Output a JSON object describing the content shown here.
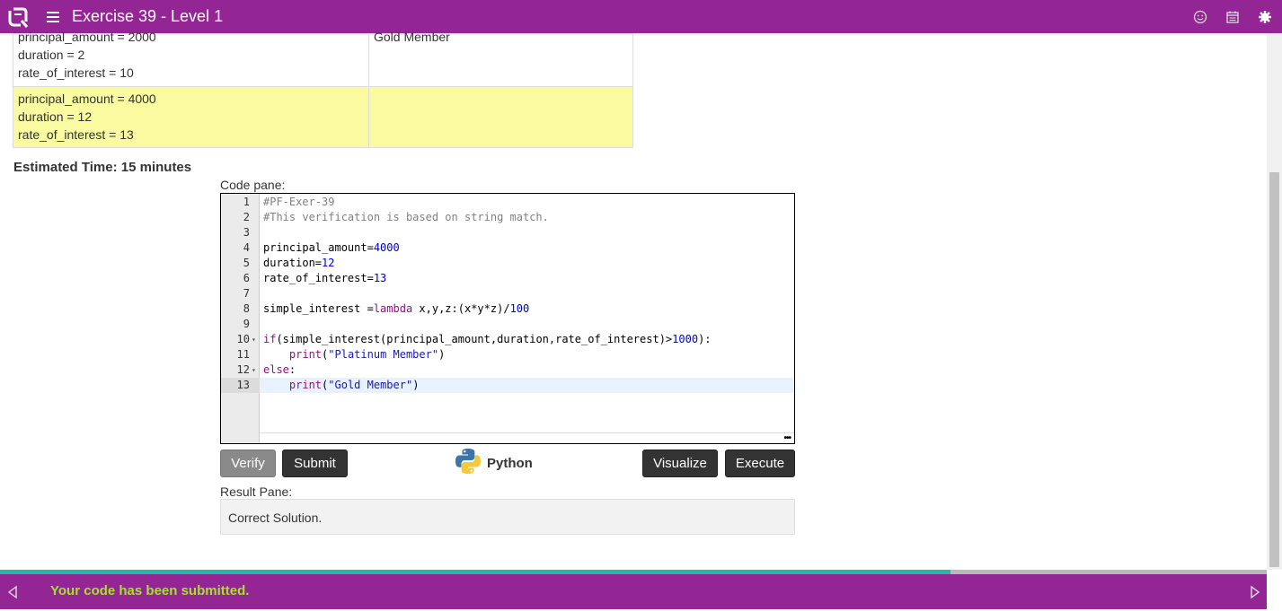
{
  "header": {
    "title": "Exercise 39 - Level 1",
    "icons": [
      "logo-icon",
      "menu-icon",
      "smiley-icon",
      "calendar-icon",
      "settings-icon"
    ]
  },
  "table": {
    "rows": [
      {
        "input": [
          "principal_amount = 2000",
          "duration = 2",
          "rate_of_interest = 10"
        ],
        "output": "Gold Member",
        "highlighted": false
      },
      {
        "input": [
          "principal_amount = 4000",
          "duration = 12",
          "rate_of_interest = 13"
        ],
        "output": "",
        "highlighted": true
      }
    ]
  },
  "estimated_time": "Estimated Time: 15 minutes",
  "code_pane": {
    "label": "Code pane:",
    "line_numbers": [
      "1",
      "2",
      "3",
      "4",
      "5",
      "6",
      "7",
      "8",
      "9",
      "10",
      "11",
      "12",
      "13"
    ],
    "lines": [
      "#PF-Exer-39",
      "#This verification is based on string match.",
      "",
      "principal_amount=4000",
      "duration=12",
      "rate_of_interest=13",
      "",
      "simple_interest =lambda x,y,z:(x*y*z)/100",
      "",
      "if(simple_interest(principal_amount,duration,rate_of_interest)>1000):",
      "    print(\"Platinum Member\")",
      "else:",
      "    print(\"Gold Member\")"
    ],
    "active_line": 13,
    "more_indicator": "•••"
  },
  "buttons": {
    "verify": "Verify",
    "submit": "Submit",
    "visualize": "Visualize",
    "execute": "Execute"
  },
  "language": "Python",
  "result_pane": {
    "label": "Result Pane:",
    "text": "Correct Solution."
  },
  "footer": {
    "message": "Your code has been submitted.",
    "progress": 0.75
  },
  "colors": {
    "brand": "#942594",
    "highlight_row": "#fafaa0",
    "progress": "#2ab5aa",
    "message": "#a6e22e"
  }
}
